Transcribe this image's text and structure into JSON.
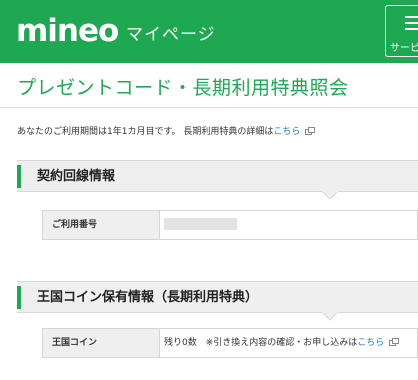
{
  "header": {
    "logo": "mineo",
    "subtitle": "マイページ",
    "service_button_label": "サービス",
    "brand_color": "#1ea851"
  },
  "page": {
    "title": "プレゼントコード・長期利用特典照会",
    "notice_text": "あなたのご利用期間は1年1カ月目です。 長期利用特典の詳細は",
    "notice_link": "こちら",
    "link_color": "#1a7fd0"
  },
  "contract_section": {
    "heading": "契約回線情報",
    "rows": [
      {
        "label": "ご利用番号",
        "value": ""
      }
    ]
  },
  "coin_section": {
    "heading": "王国コイン保有情報（長期利用特典）",
    "rows": [
      {
        "label": "王国コイン",
        "value": "残り0数　※引き換え内容の確認・お申し込みは",
        "link": "こちら"
      }
    ]
  },
  "icons": [
    "external-link-icon",
    "service-menu-icon"
  ]
}
